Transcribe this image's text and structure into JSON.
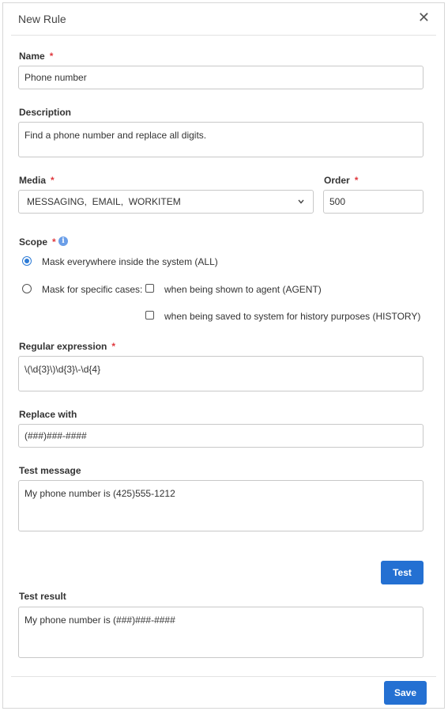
{
  "dialog": {
    "title": "New Rule",
    "close_glyph": "✕"
  },
  "required_marker": "*",
  "name": {
    "label": "Name",
    "value": "Phone number"
  },
  "description": {
    "label": "Description",
    "value": "Find a phone number and replace all digits."
  },
  "media": {
    "label": "Media",
    "value": "MESSAGING,  EMAIL,  WORKITEM",
    "icon": "chevron-down-icon"
  },
  "order": {
    "label": "Order",
    "value": "500"
  },
  "scope": {
    "label": "Scope",
    "info_glyph": "i",
    "option_all": "Mask everywhere inside the system (ALL)",
    "option_specific": "Mask for specific cases:",
    "case_agent": "when being shown to agent (AGENT)",
    "case_history": "when being saved to system for history purposes (HISTORY)",
    "selected": "ALL"
  },
  "regex": {
    "label": "Regular expression",
    "value": "\\(\\d{3}\\)\\d{3}\\-\\d{4}"
  },
  "replace": {
    "label": "Replace with",
    "value": "(###)###-####"
  },
  "test_message": {
    "label": "Test message",
    "value": "My phone number is (425)555-1212"
  },
  "test_button": "Test",
  "test_result": {
    "label": "Test result",
    "value": "My phone number is (###)###-####"
  },
  "save_button": "Save",
  "colors": {
    "accent": "#2470d2",
    "required": "#e0393e",
    "border": "#c8c8c8"
  }
}
